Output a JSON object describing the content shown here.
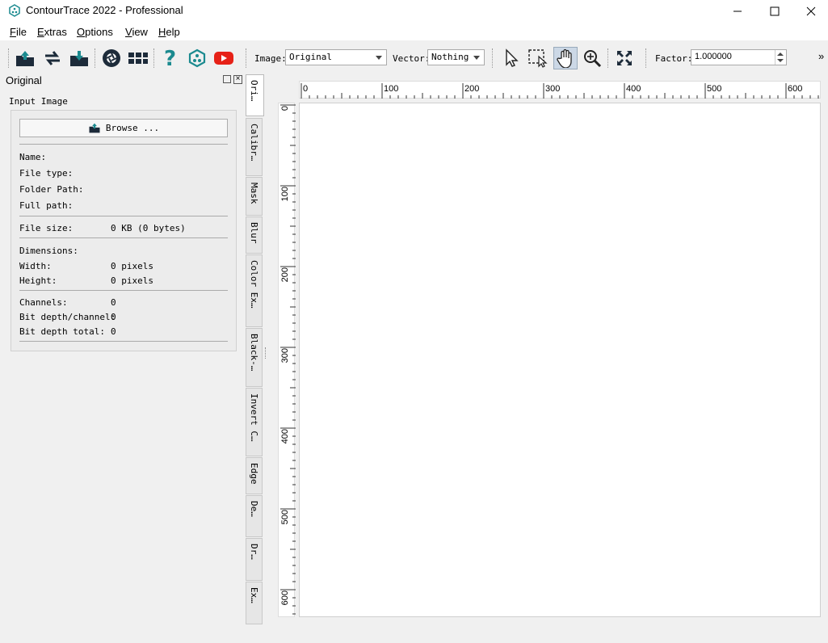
{
  "window": {
    "title": "ContourTrace 2022 - Professional",
    "minimize_glyph": "—",
    "maximize_glyph": "☐",
    "close_glyph": "✕"
  },
  "menu": [
    {
      "key": "F",
      "rest": "ile"
    },
    {
      "key": "E",
      "rest": "xtras"
    },
    {
      "key": "O",
      "rest": "ptions"
    },
    {
      "key": "V",
      "rest": "iew"
    },
    {
      "key": "H",
      "rest": "elp"
    }
  ],
  "toolbar": {
    "image_label": "Image:",
    "image_value": "Original",
    "vector_label": "Vector:",
    "vector_value": "Nothing",
    "factor_label": "Factor:",
    "factor_value": "1.000000",
    "overflow": "»"
  },
  "icons": {
    "open": "open-folder-icon",
    "refresh": "refresh-icon",
    "save": "save-icon",
    "aperture": "aperture-icon",
    "grid": "grid-icon",
    "help": "help-icon",
    "logo": "contourtrace-logo-icon",
    "youtube": "youtube-icon",
    "pointer": "pointer-icon",
    "select": "selection-icon",
    "pan": "hand-pan-icon",
    "zoom": "zoom-icon",
    "fit": "fit-screen-icon"
  },
  "colors": {
    "accent_teal": "#1b8a8f",
    "youtube_red": "#e62117",
    "active_tool": "#ccd8e6"
  },
  "panel": {
    "title": "Original",
    "subtitle": "Input Image",
    "browse_label": "Browse ...",
    "close_glyph": "×",
    "fields": {
      "name_label": "Name:",
      "file_type_label": "File type:",
      "folder_path_label": "Folder Path:",
      "full_path_label": "Full path:",
      "file_size_label": "File size:",
      "file_size_value": "0 KB (0 bytes)",
      "dimensions_label": "Dimensions:",
      "width_label": "Width:",
      "width_value": "0 pixels",
      "height_label": "Height:",
      "height_value": "0 pixels",
      "channels_label": "Channels:",
      "channels_value": "0",
      "bit_depth_channel_label": "Bit depth/channel:",
      "bit_depth_channel_value": "0",
      "bit_depth_total_label": "Bit depth total:",
      "bit_depth_total_value": "0"
    }
  },
  "tabs": [
    "Ori…",
    "Calibr…",
    "Mask",
    "Blur",
    "Color Ex…",
    "Black-…",
    "Invert C…",
    "Edge",
    "De…",
    "Dr…",
    "Ex…"
  ],
  "rulers": {
    "horizontal": [
      "0",
      "100",
      "200",
      "300",
      "400",
      "500",
      "600"
    ],
    "vertical": [
      "0",
      "100",
      "200",
      "300",
      "400",
      "500",
      "600"
    ]
  }
}
